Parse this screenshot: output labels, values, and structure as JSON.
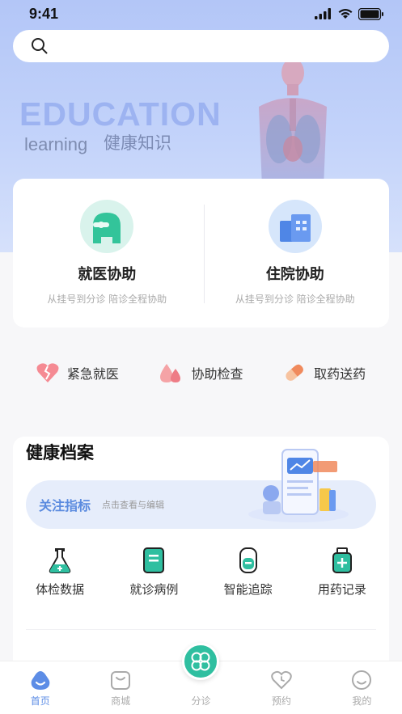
{
  "status": {
    "time": "9:41"
  },
  "search": {
    "placeholder": ""
  },
  "banner": {
    "title": "EDUCATION",
    "subtitle_en": "learning",
    "subtitle_cn": "健康知识"
  },
  "services": [
    {
      "title": "就医协助",
      "desc": "从挂号到分诊 陪诊全程协助",
      "icon": "doctor-icon"
    },
    {
      "title": "住院协助",
      "desc": "从挂号到分诊 陪诊全程协助",
      "icon": "hospital-building-icon"
    }
  ],
  "quick": [
    {
      "label": "紧急就医",
      "icon": "broken-heart-icon",
      "color": "#f0707a"
    },
    {
      "label": "协助检查",
      "icon": "blood-drop-icon",
      "color": "#f08a8e"
    },
    {
      "label": "取药送药",
      "icon": "pill-icon",
      "color": "#f5a46e"
    }
  ],
  "health": {
    "title": "健康档案",
    "focus_label": "关注指标",
    "focus_hint": "点击查看与编辑",
    "records": [
      {
        "label": "体检数据",
        "icon": "flask-icon"
      },
      {
        "label": "就诊病例",
        "icon": "record-book-icon"
      },
      {
        "label": "智能追踪",
        "icon": "tracker-device-icon"
      },
      {
        "label": "用药记录",
        "icon": "medicine-bottle-icon"
      }
    ]
  },
  "tabs": [
    {
      "label": "首页",
      "icon": "home-icon",
      "active": true
    },
    {
      "label": "商城",
      "icon": "shop-icon",
      "active": false
    },
    {
      "label": "分诊",
      "icon": "triage-icon",
      "active": false
    },
    {
      "label": "预约",
      "icon": "heart-clock-icon",
      "active": false
    },
    {
      "label": "我的",
      "icon": "smile-icon",
      "active": false
    }
  ],
  "colors": {
    "accent": "#5d8de6",
    "teal": "#2fbfa0",
    "hero": "#b3c6f7"
  }
}
